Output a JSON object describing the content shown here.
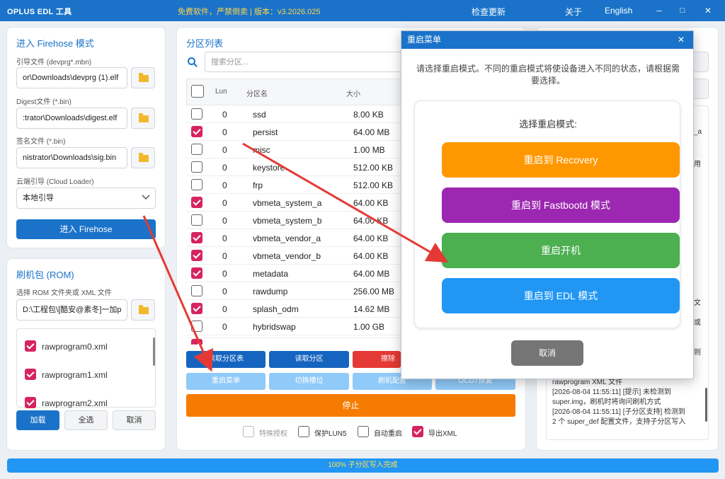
{
  "titlebar": {
    "app_title": "OPLUS EDL 工具",
    "version": "免费软件，严禁倒卖 | 版本：v3.2026.025",
    "check_update": "检查更新",
    "about": "关于",
    "language": "English",
    "minimize": "–",
    "maximize": "□",
    "close": "✕"
  },
  "firehose": {
    "title": "进入 Firehose 模式",
    "loader_label": "引导文件 (devprg*.mbn)",
    "loader_value": "or\\Downloads\\devprg (1).elf",
    "digest_label": "Digest文件 (*.bin)",
    "digest_value": ":trator\\Downloads\\digest.elf",
    "sig_label": "签名文件 (*.bin)",
    "sig_value": "nistrator\\Downloads\\sig.bin",
    "cloud_label": "云端引导 (Cloud Loader)",
    "cloud_value": "本地引导",
    "enter_button": "进入 Firehose"
  },
  "rom": {
    "title": "刷机包 (ROM)",
    "select_label": "选择 ROM 文件夹或 XML 文件",
    "path_value": "D:\\工程包\\[酷安@素冬]一加p",
    "files": [
      "rawprogram0.xml",
      "rawprogram1.xml",
      "rawprogram2.xml"
    ],
    "load_button": "加载",
    "select_all_button": "全选",
    "cancel_button": "取消"
  },
  "partitions": {
    "title": "分区列表",
    "search_placeholder": "搜索分区...",
    "headers": {
      "lun": "Lun",
      "name": "分区名",
      "size": "大小"
    },
    "rows": [
      {
        "lun": "0",
        "name": "ssd",
        "size": "8.00 KB",
        "checked": false
      },
      {
        "lun": "0",
        "name": "persist",
        "size": "64.00 MB",
        "checked": true
      },
      {
        "lun": "0",
        "name": "misc",
        "size": "1.00 MB",
        "checked": false
      },
      {
        "lun": "0",
        "name": "keystore",
        "size": "512.00 KB",
        "checked": false
      },
      {
        "lun": "0",
        "name": "frp",
        "size": "512.00 KB",
        "checked": false
      },
      {
        "lun": "0",
        "name": "vbmeta_system_a",
        "size": "64.00 KB",
        "checked": true
      },
      {
        "lun": "0",
        "name": "vbmeta_system_b",
        "size": "64.00 KB",
        "checked": false
      },
      {
        "lun": "0",
        "name": "vbmeta_vendor_a",
        "size": "64.00 KB",
        "checked": true
      },
      {
        "lun": "0",
        "name": "vbmeta_vendor_b",
        "size": "64.00 KB",
        "checked": true
      },
      {
        "lun": "0",
        "name": "metadata",
        "size": "64.00 MB",
        "checked": true
      },
      {
        "lun": "0",
        "name": "rawdump",
        "size": "256.00 MB",
        "checked": false
      },
      {
        "lun": "0",
        "name": "splash_odm",
        "size": "14.62 MB",
        "checked": true
      },
      {
        "lun": "0",
        "name": "hybridswap",
        "size": "1.00 GB",
        "checked": false
      }
    ],
    "btn_read_table": "读取分区表",
    "btn_read_part": "读取分区",
    "btn_erase": "擦除分",
    "btn_reboot_menu": "重启菜单",
    "btn_switch_slot": "切换槽位",
    "btn_flash_config": "刷机配置",
    "btn_ocdt": "OCDT修复",
    "btn_stop": "停止",
    "opt_special": "特殊授权",
    "opt_protect": "保护LUN5",
    "opt_autoreboot": "自动重启",
    "opt_export": "导出XML"
  },
  "dialog": {
    "title": "重启菜单",
    "close": "✕",
    "description_line1": "请选择重启模式。不同的重启模式将使设备进入不同的状态，请根据需",
    "description_line2": "要选择。",
    "select_label": "选择重启模式:",
    "recovery": "重启到 Recovery",
    "fastbootd": "重启到 Fastbootd 模式",
    "system": "重启开机",
    "edl": "重启到 EDL 模式",
    "cancel": "取消",
    "colors": {
      "recovery": "#ff9800",
      "fastbootd": "#9c27b0",
      "system": "#4caf50",
      "edl": "#2196f3"
    }
  },
  "log": {
    "fragments": [
      "_a",
      "用",
      "文",
      "或",
      "则"
    ],
    "lines": [
      "rawprogram XML 文件",
      "[2026-08-04 11:55:11] [提示] 未检测到",
      "super.img，刷机时将询问刷机方式",
      "[2026-08-04 11:55:11] [子分区支持] 检测到",
      "2 个 super_def 配置文件，支持子分区写入"
    ]
  },
  "status": {
    "progress_text": "100% 子分区写入完成",
    "progress": 1.0
  }
}
